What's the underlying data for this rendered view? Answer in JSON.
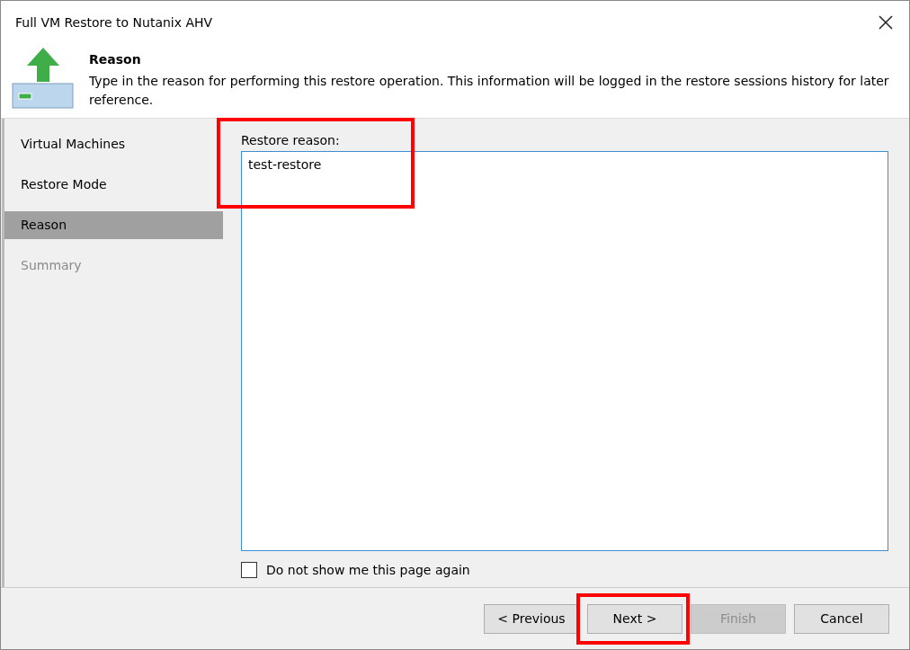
{
  "window": {
    "title": "Full VM Restore to Nutanix AHV"
  },
  "header": {
    "title": "Reason",
    "description": "Type in the reason for performing this restore operation. This information will be logged in the restore sessions history for later reference."
  },
  "steps": [
    {
      "label": "Virtual Machines",
      "selected": false,
      "disabled": false
    },
    {
      "label": "Restore Mode",
      "selected": false,
      "disabled": false
    },
    {
      "label": "Reason",
      "selected": true,
      "disabled": false
    },
    {
      "label": "Summary",
      "selected": false,
      "disabled": true
    }
  ],
  "reason_field": {
    "label": "Restore reason:",
    "value": "test-restore",
    "highlighted": true
  },
  "dont_show_again": {
    "label": "Do not show me this page again",
    "checked": false
  },
  "buttons": [
    {
      "label": "< Previous",
      "disabled": false,
      "highlighted": false
    },
    {
      "label": "Next >",
      "disabled": false,
      "highlighted": true
    },
    {
      "label": "Finish",
      "disabled": true,
      "highlighted": false
    },
    {
      "label": "Cancel",
      "disabled": false,
      "highlighted": false
    }
  ]
}
